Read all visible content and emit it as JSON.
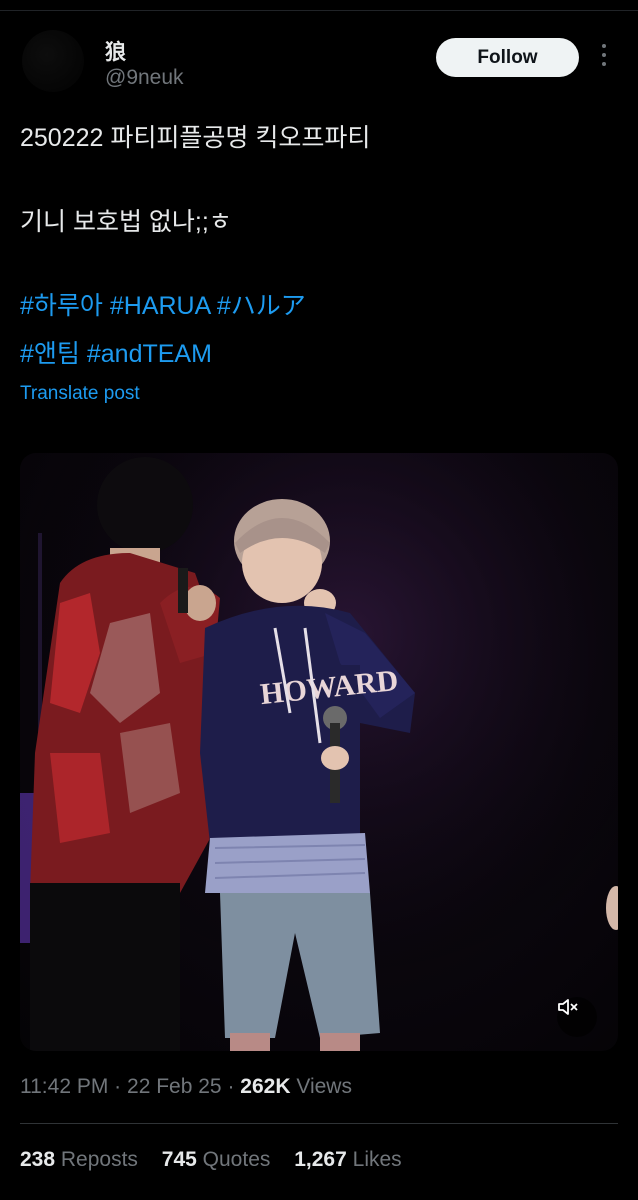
{
  "tweet": {
    "author": {
      "display_name": "狼",
      "handle": "@9neuk"
    },
    "follow_label": "Follow",
    "lines": [
      "250222 파티피플공명 킥오프파티",
      "기니 보호법 없나;;ㅎ"
    ],
    "hashtags_line1": [
      "#하루아",
      "#HARUA",
      "#ハルア"
    ],
    "hashtags_line2": [
      "#앤팀",
      "#andTEAM"
    ],
    "translate_label": "Translate post",
    "media": {
      "hoodie_text": "HOWARD",
      "type": "video"
    },
    "meta": {
      "time": "11:42 PM",
      "date": "22 Feb 25",
      "views_count": "262K",
      "views_label": "Views",
      "separator": "·"
    },
    "stats": {
      "reposts_count": "238",
      "reposts_label": "Reposts",
      "quotes_count": "745",
      "quotes_label": "Quotes",
      "likes_count": "1,267",
      "likes_label": "Likes"
    }
  },
  "colors": {
    "background": "#000000",
    "text": "#e7e9ea",
    "muted": "#71767b",
    "link": "#1d9bf0",
    "button_bg": "#eff3f4"
  }
}
